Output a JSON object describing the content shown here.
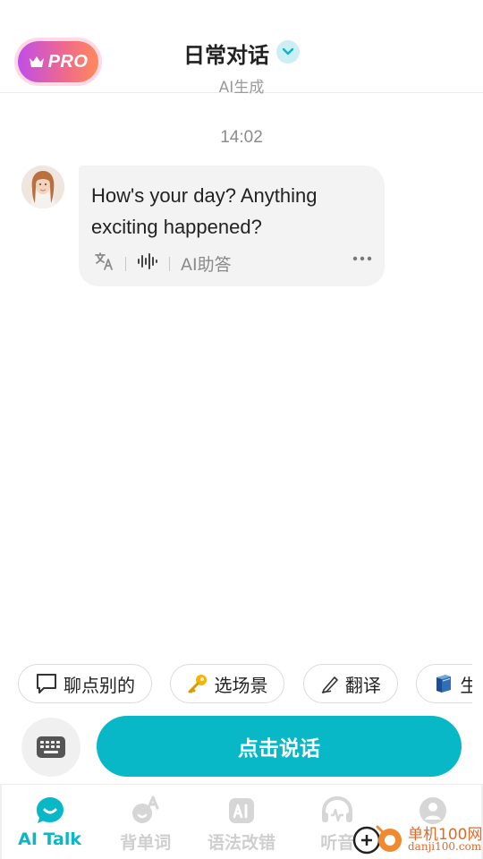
{
  "header": {
    "pro_label": "PRO",
    "title": "日常对话",
    "subtitle": "AI生成"
  },
  "chat": {
    "timestamp": "14:02",
    "messages": [
      {
        "role": "assistant",
        "text_line1": "How's your day? Anything",
        "text_line2": "exciting happened?",
        "actions": {
          "translate_icon": "translate-icon",
          "audio_icon": "audio-wave-icon",
          "ai_answer_label": "AI助答",
          "more_icon": "more-icon"
        }
      }
    ]
  },
  "chips": [
    {
      "icon": "speech-bubble-icon",
      "label": "聊点别的"
    },
    {
      "icon": "key-icon",
      "label": "选场景"
    },
    {
      "icon": "pen-icon",
      "label": "翻译"
    },
    {
      "icon": "book-icon",
      "label": "生"
    }
  ],
  "input": {
    "keyboard_icon": "keyboard-icon",
    "talk_label": "点击说话"
  },
  "tabbar": {
    "tabs": [
      {
        "label": "AI Talk",
        "icon": "ai-talk-icon",
        "active": true
      },
      {
        "label": "背单词",
        "icon": "vocab-icon",
        "active": false
      },
      {
        "label": "语法改错",
        "icon": "grammar-icon",
        "active": false
      },
      {
        "label": "听音",
        "icon": "headphones-icon",
        "active": false
      },
      {
        "label": "",
        "icon": "profile-icon",
        "active": false
      }
    ]
  },
  "watermark": {
    "text1": "单机100网",
    "text2": "danji100.com"
  },
  "colors": {
    "accent": "#09b8c6",
    "pro_gradient_start": "#c04ee8",
    "pro_gradient_end": "#ff8a5a",
    "inactive_tab": "#cfcfcf"
  }
}
